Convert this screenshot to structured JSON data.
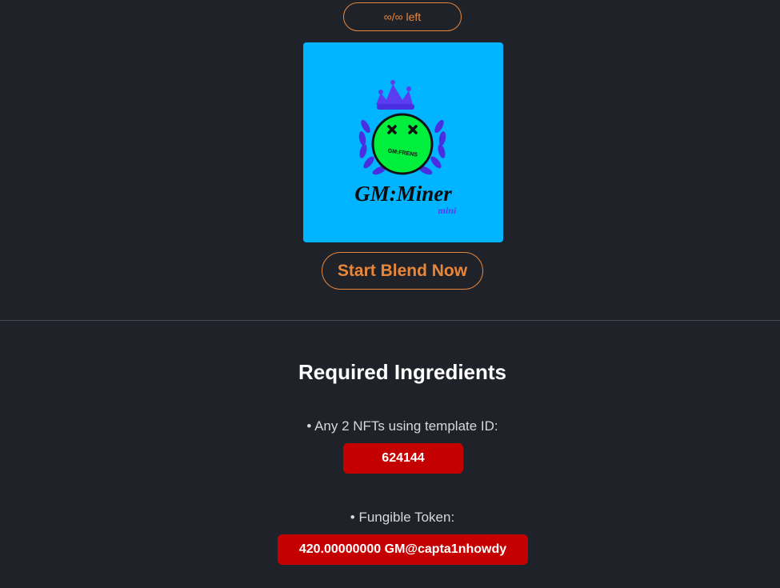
{
  "blend": {
    "remaining_label": "∞/∞ left",
    "nft_image": {
      "logo_title": "GM:Miner",
      "logo_subtitle": "mini",
      "badge_text": "GM:FRENS",
      "background_color": "#00b4ff"
    },
    "start_button_label": "Start Blend Now"
  },
  "ingredients": {
    "title": "Required Ingredients",
    "items": [
      {
        "label": "• Any 2 NFTs using template ID:",
        "value": "624144"
      },
      {
        "label": "• Fungible Token:",
        "value": "420.00000000 GM@capta1nhowdy"
      }
    ]
  },
  "colors": {
    "background": "#20222a",
    "accent": "#e8873a",
    "badge": "#c40000"
  }
}
